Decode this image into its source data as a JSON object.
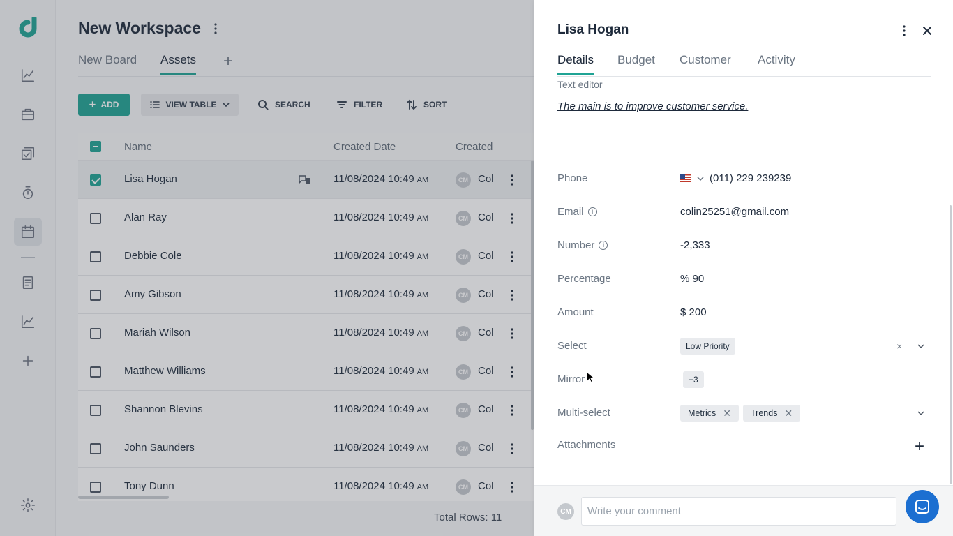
{
  "workspace": {
    "title": "New Workspace",
    "tabs": [
      {
        "label": "New Board"
      },
      {
        "label": "Assets"
      }
    ]
  },
  "toolbar": {
    "add_label": "ADD",
    "view_label": "VIEW TABLE",
    "search_label": "SEARCH",
    "filter_label": "FILTER",
    "sort_label": "SORT"
  },
  "table": {
    "columns": [
      "Name",
      "Created Date",
      "Created"
    ],
    "rows": [
      {
        "name": "Lisa Hogan",
        "date": "11/08/2024 10:49",
        "ampm": "AM",
        "initials": "CM",
        "by": "Col",
        "selected": true
      },
      {
        "name": "Alan Ray",
        "date": "11/08/2024 10:49",
        "ampm": "AM",
        "initials": "CM",
        "by": "Col"
      },
      {
        "name": "Debbie Cole",
        "date": "11/08/2024 10:49",
        "ampm": "AM",
        "initials": "CM",
        "by": "Col"
      },
      {
        "name": "Amy Gibson",
        "date": "11/08/2024 10:49",
        "ampm": "AM",
        "initials": "CM",
        "by": "Col"
      },
      {
        "name": "Mariah Wilson",
        "date": "11/08/2024 10:49",
        "ampm": "AM",
        "initials": "CM",
        "by": "Col"
      },
      {
        "name": "Matthew Williams",
        "date": "11/08/2024 10:49",
        "ampm": "AM",
        "initials": "CM",
        "by": "Col"
      },
      {
        "name": "Shannon Blevins",
        "date": "11/08/2024 10:49",
        "ampm": "AM",
        "initials": "CM",
        "by": "Col"
      },
      {
        "name": "John Saunders",
        "date": "11/08/2024 10:49",
        "ampm": "AM",
        "initials": "CM",
        "by": "Col"
      },
      {
        "name": "Tony Dunn",
        "date": "11/08/2024 10:49",
        "ampm": "AM",
        "initials": "CM",
        "by": "Col"
      }
    ],
    "total_rows": "Total Rows: 11"
  },
  "panel": {
    "title": "Lisa Hogan",
    "tabs": [
      {
        "label": "Details"
      },
      {
        "label": "Budget"
      },
      {
        "label": "Customer"
      },
      {
        "label": "Activity"
      }
    ],
    "text_editor_label": "Text editor",
    "text_editor_value": "The main is to improve customer service.",
    "fields": {
      "phone": {
        "label": "Phone",
        "value": "(011) 229 239239"
      },
      "email": {
        "label": "Email",
        "value": "colin25251@gmail.com"
      },
      "number": {
        "label": "Number",
        "value": "-2,333"
      },
      "percentage": {
        "label": "Percentage",
        "value": "% 90"
      },
      "amount": {
        "label": "Amount",
        "value": "$ 200"
      },
      "select": {
        "label": "Select",
        "value": "Low Priority"
      },
      "mirror": {
        "label": "Mirror",
        "value": "+3"
      },
      "multiselect": {
        "label": "Multi-select",
        "values": [
          "Metrics",
          "Trends"
        ]
      },
      "attachments": {
        "label": "Attachments"
      }
    },
    "comment": {
      "avatar": "CM",
      "placeholder": "Write your comment"
    }
  },
  "colors": {
    "accent": "#1fa394",
    "chat": "#1c6fd1"
  }
}
